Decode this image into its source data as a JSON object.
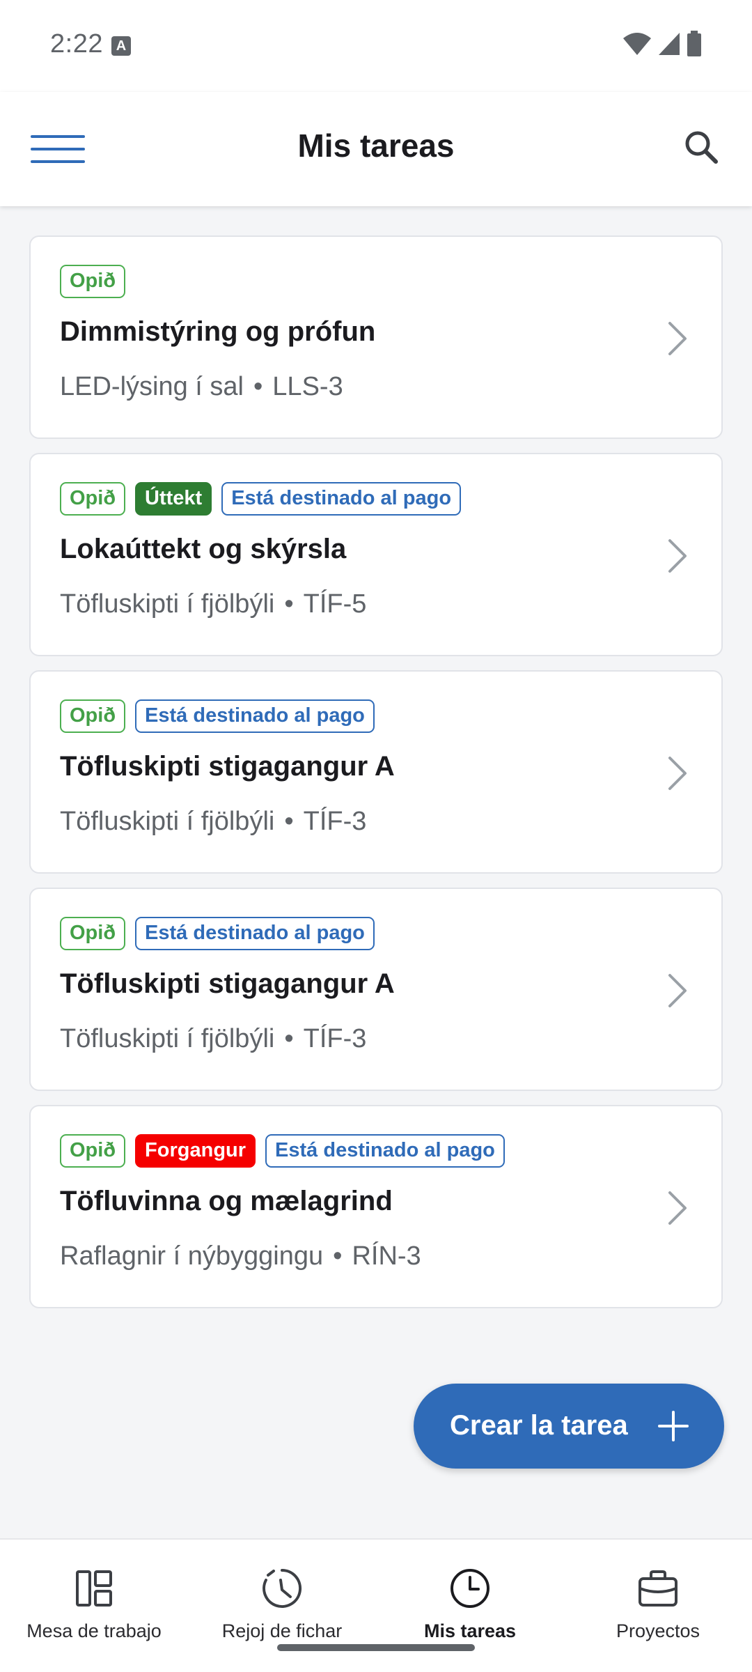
{
  "status_bar": {
    "time": "2:22"
  },
  "app_bar": {
    "title": "Mis tareas"
  },
  "tasks": [
    {
      "badges": [
        {
          "label": "Opið",
          "type": "open"
        }
      ],
      "title": "Dimmistýring og prófun",
      "project": "LED-lýsing í sal",
      "separator": "•",
      "code": "LLS-3"
    },
    {
      "badges": [
        {
          "label": "Opið",
          "type": "open"
        },
        {
          "label": "Úttekt",
          "type": "inspected"
        },
        {
          "label": "Está destinado al pago",
          "type": "payment"
        }
      ],
      "title": "Lokaúttekt og skýrsla",
      "project": "Töfluskipti í fjölbýli",
      "separator": "•",
      "code": "TÍF-5"
    },
    {
      "badges": [
        {
          "label": "Opið",
          "type": "open"
        },
        {
          "label": "Está destinado al pago",
          "type": "payment"
        }
      ],
      "title": "Töfluskipti stigagangur A",
      "project": "Töfluskipti í fjölbýli",
      "separator": "•",
      "code": "TÍF-3"
    },
    {
      "badges": [
        {
          "label": "Opið",
          "type": "open"
        },
        {
          "label": "Está destinado al pago",
          "type": "payment"
        }
      ],
      "title": "Töfluskipti stigagangur A",
      "project": "Töfluskipti í fjölbýli",
      "separator": "•",
      "code": "TÍF-3"
    },
    {
      "badges": [
        {
          "label": "Opið",
          "type": "open"
        },
        {
          "label": "Forgangur",
          "type": "priority"
        },
        {
          "label": "Está destinado al pago",
          "type": "payment"
        }
      ],
      "title": "Töfluvinna og mælagrind",
      "project": "Raflagnir í nýbyggingu",
      "separator": "•",
      "code": "RÍN-3"
    }
  ],
  "fab": {
    "label": "Crear la tarea",
    "icon": "plus-icon"
  },
  "bottom_nav": [
    {
      "label": "Mesa de trabajo",
      "icon": "dashboard-icon",
      "active": false
    },
    {
      "label": "Rejoj de fichar",
      "icon": "time-clock-icon",
      "active": false
    },
    {
      "label": "Mis tareas",
      "icon": "clock-icon",
      "active": true
    },
    {
      "label": "Proyectos",
      "icon": "briefcase-icon",
      "active": false
    }
  ],
  "colors": {
    "accent": "#2f6bb8",
    "open": "#43a047",
    "inspected": "#2e7d32",
    "priority": "#f50000",
    "background": "#f4f5f7"
  }
}
